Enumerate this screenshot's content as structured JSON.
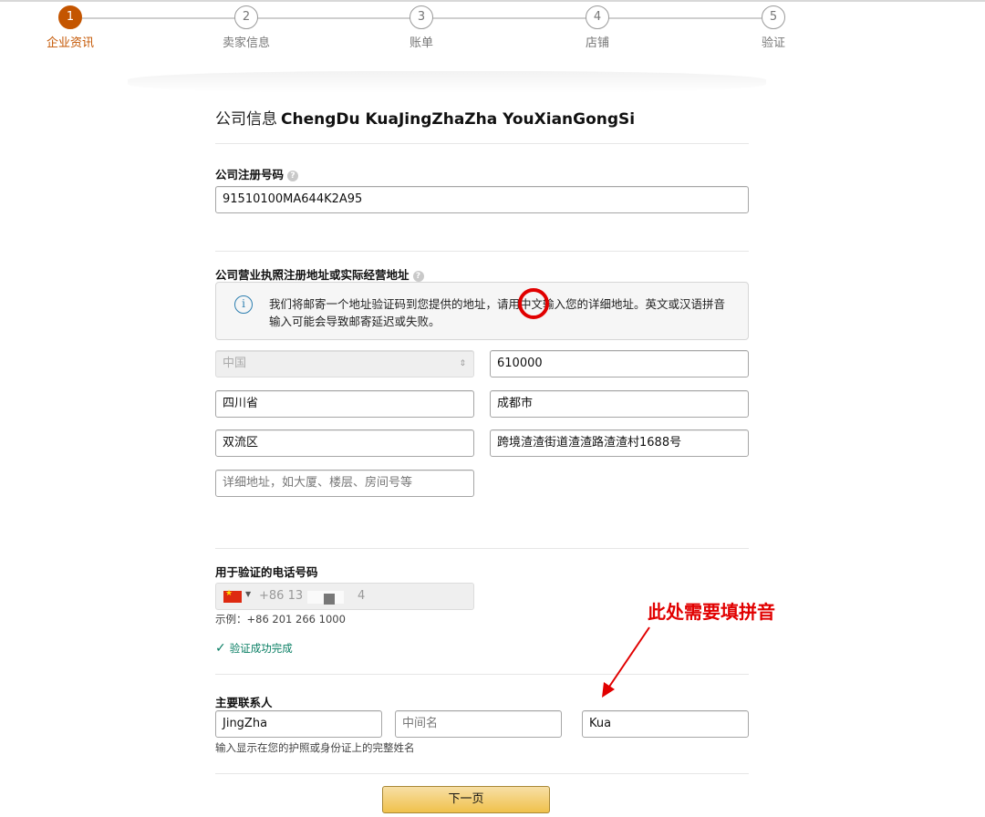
{
  "stepper": {
    "steps": [
      {
        "number": "1",
        "label": "企业资讯",
        "active": true
      },
      {
        "number": "2",
        "label": "卖家信息",
        "active": false
      },
      {
        "number": "3",
        "label": "账单",
        "active": false
      },
      {
        "number": "4",
        "label": "店铺",
        "active": false
      },
      {
        "number": "5",
        "label": "验证",
        "active": false
      }
    ],
    "active_color": "#c45500"
  },
  "company": {
    "title_label": "公司信息",
    "name": "ChengDu KuaJingZhaZha YouXianGongSi"
  },
  "registration": {
    "label": "公司注册号码",
    "help_icon": "?",
    "value": "91510100MA644K2A95"
  },
  "address": {
    "label": "公司营业执照注册地址或实际经营地址",
    "help_icon": "?",
    "info_icon": "i",
    "info_text": "我们将邮寄一个地址验证码到您提供的地址，请用中文输入您的详细地址。英文或汉语拼音输入可能会导致邮寄延迟或失败。",
    "country": "中国",
    "country_arrow": "⇕",
    "postal_code": "610000",
    "province": "四川省",
    "city": "成都市",
    "district": "双流区",
    "street": "跨境渣渣街道渣渣路渣渣村1688号",
    "detail_placeholder": "详细地址，如大厦、楼层、房间号等"
  },
  "phone": {
    "label": "用于验证的电话号码",
    "country_code_text": "+86 13",
    "end_digit": "4",
    "example": "示例：+86 201 266 1000",
    "verified_text": "验证成功完成",
    "verified_color": "#067d62"
  },
  "contact": {
    "label": "主要联系人",
    "first_name": "JingZha",
    "middle_placeholder": "中间名",
    "last_name": "Kua",
    "hint": "输入显示在您的护照或身份证上的完整姓名"
  },
  "annotation": {
    "text": "此处需要填拼音",
    "color": "#e10000"
  },
  "next_button": "下一页"
}
